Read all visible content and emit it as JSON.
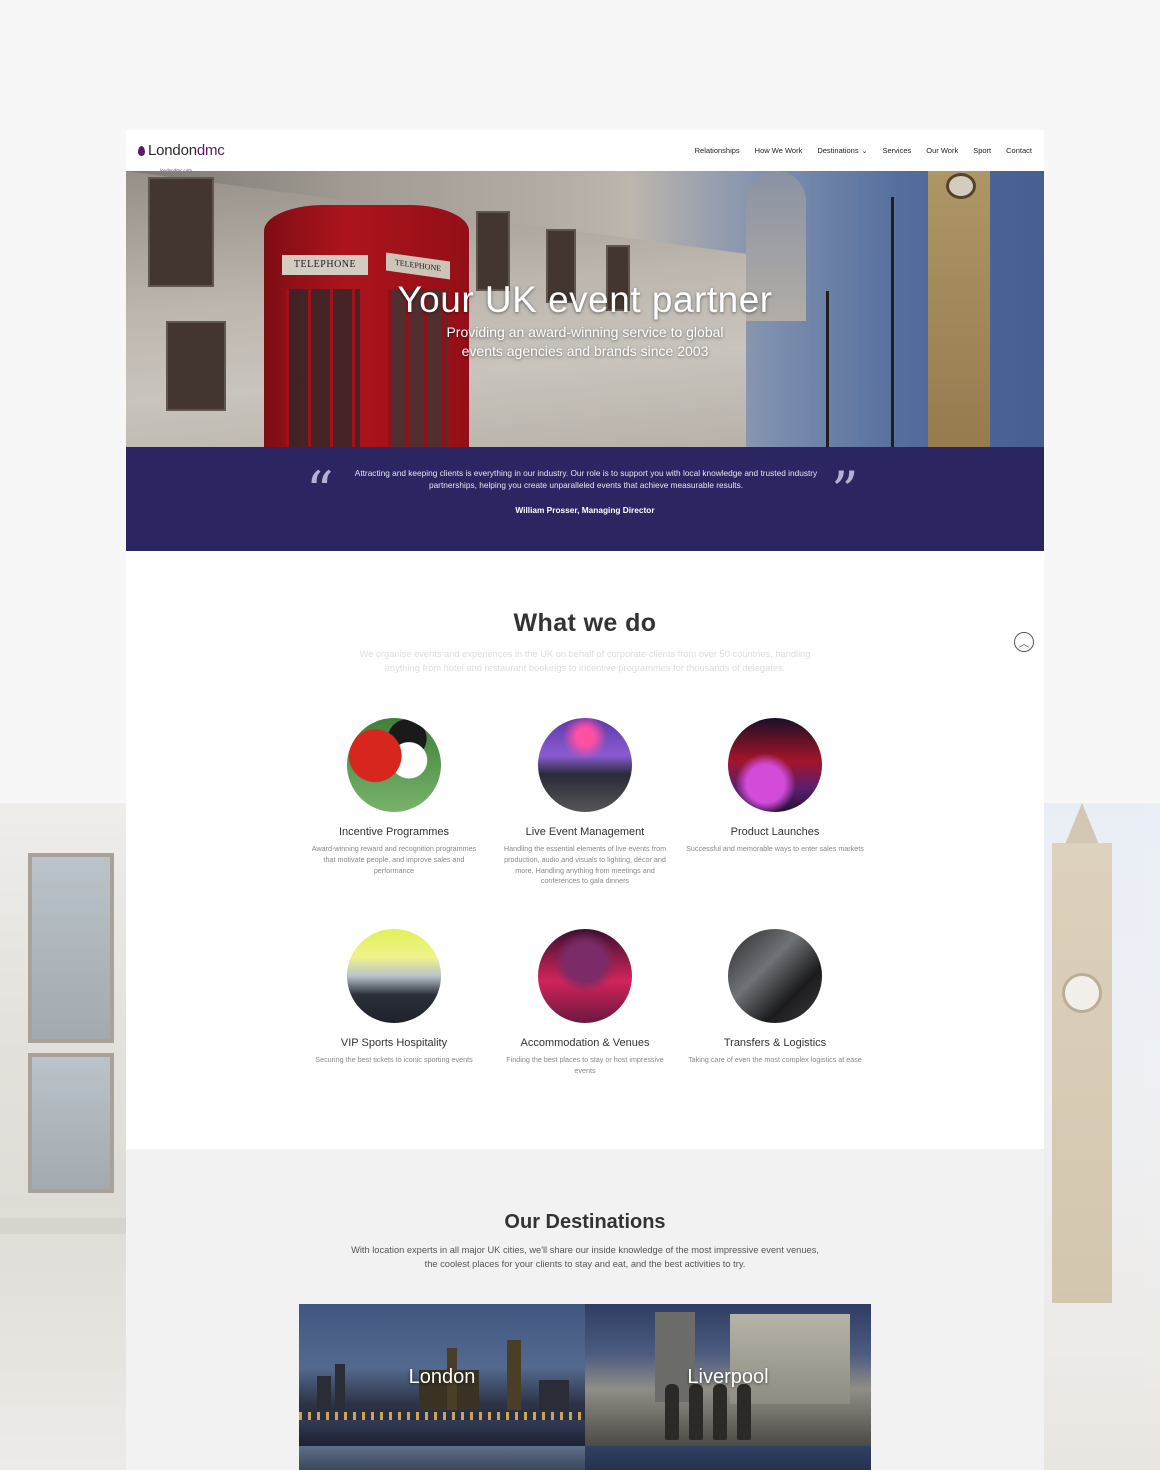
{
  "brand": {
    "name_part1": "London",
    "name_part2": "dmc",
    "tagline": "londondmc.com",
    "color": "#5c1a63"
  },
  "nav": {
    "items": [
      {
        "label": "Relationships"
      },
      {
        "label": "How We Work"
      },
      {
        "label": "Destinations",
        "has_dropdown": true
      },
      {
        "label": "Services"
      },
      {
        "label": "Our Work"
      },
      {
        "label": "Sport"
      },
      {
        "label": "Contact"
      }
    ]
  },
  "hero": {
    "title": "Your UK event partner",
    "subtitle_line1": "Providing an award-winning service to global",
    "subtitle_line2": "events agencies and brands since 2003",
    "booth_sign": "TELEPHONE",
    "booth_sign_side": "TELEPHONE"
  },
  "quote": {
    "text": "Attracting and keeping clients is everything in our industry. Our role is to support you with local knowledge and trusted industry partnerships, helping you create unparalleled events that achieve measurable results.",
    "author": "William Prosser, Managing Director",
    "band_color": "#2b2562"
  },
  "what_we_do": {
    "title": "What we do",
    "description": "We organise events and experiences in the UK on behalf of corporate clients from over 50 countries, handling anything from hotel and restaurant bookings to incentive programmes for thousands of delegates.",
    "services": [
      {
        "title": "Incentive Programmes",
        "description": "Award-winning reward and recognition programmes that motivate people, and improve sales and performance"
      },
      {
        "title": "Live Event Management",
        "description": "Handling the essential elements of live events from production, audio and visuals to lighting, décor and more. Handling anything from meetings and conferences to gala dinners"
      },
      {
        "title": "Product Launches",
        "description": "Successful and memorable ways to enter sales markets"
      },
      {
        "title": "VIP Sports Hospitality",
        "description": "Securing the best tickets to iconic sporting events"
      },
      {
        "title": "Accommodation & Venues",
        "description": "Finding the best places to stay or host impressive events"
      },
      {
        "title": "Transfers & Logistics",
        "description": "Taking care of even the most complex logistics at ease"
      }
    ]
  },
  "destinations": {
    "title": "Our Destinations",
    "description": "With location experts in all major UK cities, we'll share our inside knowledge of the most impressive event venues, the coolest places for your clients to stay and eat, and the best activities to try.",
    "cards": [
      {
        "label": "London"
      },
      {
        "label": "Liverpool"
      }
    ]
  }
}
